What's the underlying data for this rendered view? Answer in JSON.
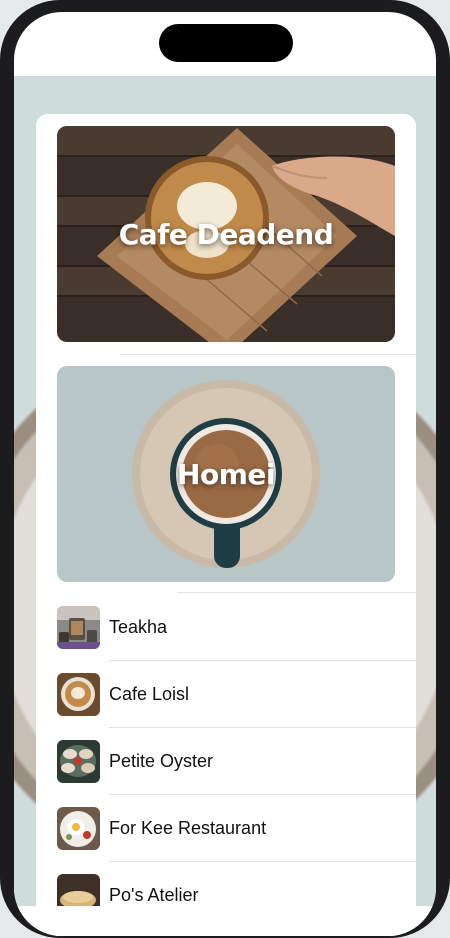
{
  "featured": [
    {
      "title": "Cafe Deadend",
      "image": "latte-art-on-wooden-tray"
    },
    {
      "title": "Homei",
      "image": "coffee-cup-on-saucer"
    }
  ],
  "restaurants": [
    {
      "name": "Teakha",
      "thumbnail": "tea-set-thumbnail"
    },
    {
      "name": "Cafe Loisl",
      "thumbnail": "latte-thumbnail"
    },
    {
      "name": "Petite Oyster",
      "thumbnail": "oysters-thumbnail"
    },
    {
      "name": "For Kee Restaurant",
      "thumbnail": "egg-dish-thumbnail"
    },
    {
      "name": "Po's Atelier",
      "thumbnail": "bread-thumbnail"
    }
  ],
  "colors": {
    "separator": "#e3e3e5",
    "background": "#cfdcdc"
  }
}
